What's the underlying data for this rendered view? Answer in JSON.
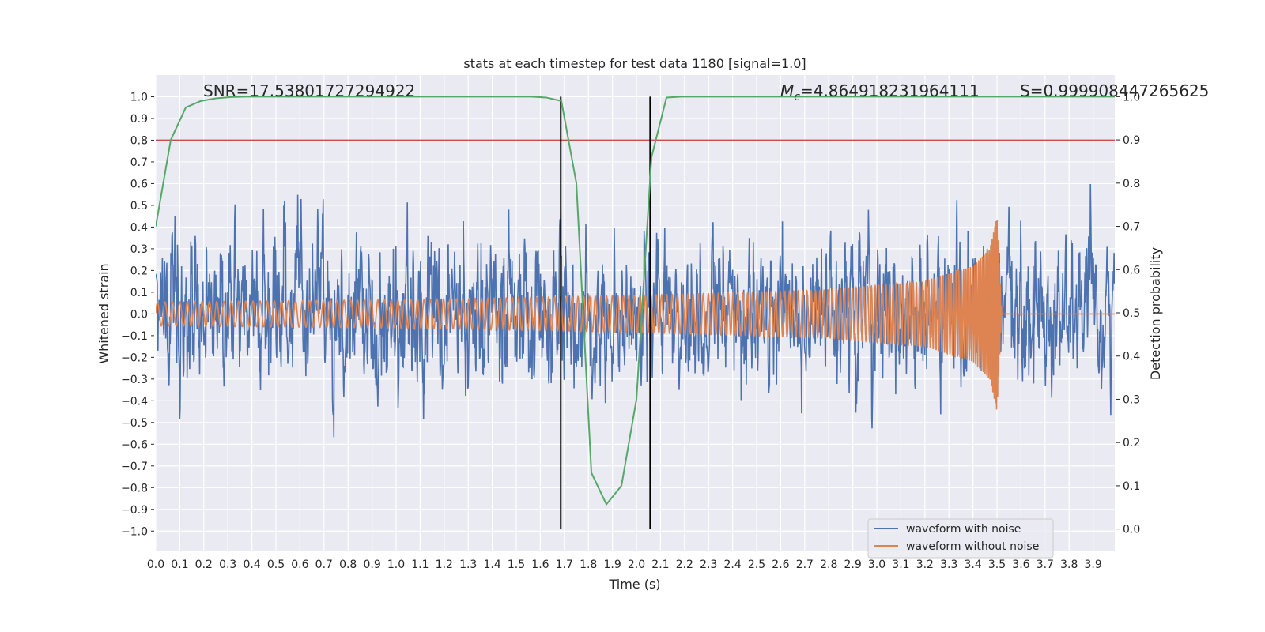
{
  "chart_data": {
    "type": "line",
    "title": "stats at each timestep for test data 1180 [signal=1.0]",
    "xlabel": "Time (s)",
    "ylabel": "Whitened strain",
    "ylabel_right": "Detection probability",
    "xlim": [
      0,
      3.99
    ],
    "ylim": [
      -1.09,
      1.1
    ],
    "ylim_right": [
      -0.05,
      1.05
    ],
    "grid": true,
    "legend_placement": "lower-right",
    "xticks": [
      "0.0",
      "0.1",
      "0.2",
      "0.3",
      "0.4",
      "0.5",
      "0.6",
      "0.7",
      "0.8",
      "0.9",
      "1.0",
      "1.1",
      "1.2",
      "1.3",
      "1.4",
      "1.5",
      "1.6",
      "1.7",
      "1.8",
      "1.9",
      "2.0",
      "2.1",
      "2.2",
      "2.3",
      "2.4",
      "2.5",
      "2.6",
      "2.7",
      "2.8",
      "2.9",
      "3.0",
      "3.1",
      "3.2",
      "3.3",
      "3.4",
      "3.5",
      "3.6",
      "3.7",
      "3.8",
      "3.9"
    ],
    "yticks": [
      "1.0",
      "0.9",
      "0.8",
      "0.7",
      "0.6",
      "0.5",
      "0.4",
      "0.3",
      "0.2",
      "0.1",
      "0.0",
      "−0.1",
      "−0.2",
      "−0.3",
      "−0.4",
      "−0.5",
      "−0.6",
      "−0.7",
      "−0.8",
      "−0.9",
      "−1.0"
    ],
    "yticks_right": [
      "1.0",
      "0.9",
      "0.8",
      "0.7",
      "0.6",
      "0.5",
      "0.4",
      "0.3",
      "0.2",
      "0.1",
      "0.0"
    ],
    "annotations": {
      "snr": "SNR=17.53801727294922",
      "mc_symbol": "M",
      "mc_sub": "c",
      "mc_value": "=4.864918231964111",
      "s": "S=0.999908447265625"
    },
    "series": [
      {
        "name": "waveform with noise",
        "color": "#4c72b0",
        "axis": "left",
        "kind": "noisy strain, typical |h| ≈ 0.2, peaks to ±0.99"
      },
      {
        "name": "waveform without noise",
        "color": "#dd8452",
        "axis": "left",
        "envelope": {
          "t": [
            0.0,
            1.0,
            2.0,
            2.8,
            3.2,
            3.4,
            3.47,
            3.5,
            3.52
          ],
          "amplitude": [
            0.055,
            0.065,
            0.085,
            0.11,
            0.15,
            0.22,
            0.3,
            0.45,
            0.0
          ]
        },
        "start_frequency_hz": 32
      },
      {
        "color": "#55a868",
        "axis": "right",
        "t": [
          0.0,
          0.0625,
          0.125,
          0.1875,
          0.25,
          0.3125,
          0.375,
          1.5,
          1.5625,
          1.625,
          1.6875,
          1.75,
          1.8125,
          1.875,
          1.9375,
          2.0,
          2.0625,
          2.125,
          2.1875,
          3.99
        ],
        "y": [
          0.7,
          0.9,
          0.975,
          0.99,
          0.996,
          0.999,
          1.0,
          1.0,
          1.0,
          0.998,
          0.99,
          0.8,
          0.13,
          0.057,
          0.1,
          0.3,
          0.86,
          0.998,
          1.0,
          1.0
        ]
      }
    ],
    "hlines": [
      {
        "y": 0.8,
        "axis": "left",
        "color": "#c44e52"
      }
    ],
    "vlines": [
      {
        "x": 1.685,
        "color": "#000000"
      },
      {
        "x": 2.057,
        "color": "#000000"
      }
    ]
  }
}
